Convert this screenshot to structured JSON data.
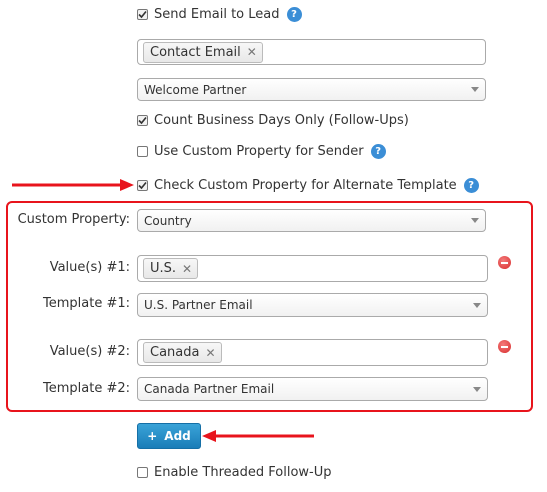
{
  "send_email": {
    "label": "Send Email to Lead",
    "checked": true,
    "help_icon": "help-icon"
  },
  "recipients": {
    "tag": "Contact Email"
  },
  "email_template": {
    "value": "Welcome Partner"
  },
  "business_days": {
    "label": "Count Business Days Only (Follow-Ups)",
    "checked": true
  },
  "custom_sender": {
    "label": "Use Custom Property for Sender",
    "checked": false,
    "help_icon": "help-icon"
  },
  "alt_template": {
    "label": "Check Custom Property for Alternate Template",
    "checked": true,
    "help_icon": "help-icon"
  },
  "custom_property": {
    "label": "Custom Property:",
    "value": "Country"
  },
  "rules": [
    {
      "values_label": "Value(s) #1:",
      "value_tag": "U.S.",
      "template_label": "Template #1:",
      "template_value": "U.S. Partner Email"
    },
    {
      "values_label": "Value(s) #2:",
      "value_tag": "Canada",
      "template_label": "Template #2:",
      "template_value": "Canada Partner Email"
    }
  ],
  "add_button": {
    "label": "Add",
    "icon": "+"
  },
  "threaded": {
    "label": "Enable Threaded Follow-Up",
    "checked": false
  },
  "colors": {
    "annotation": "#e8141c",
    "help": "#3b8ed6",
    "button": "#1a7db8"
  }
}
